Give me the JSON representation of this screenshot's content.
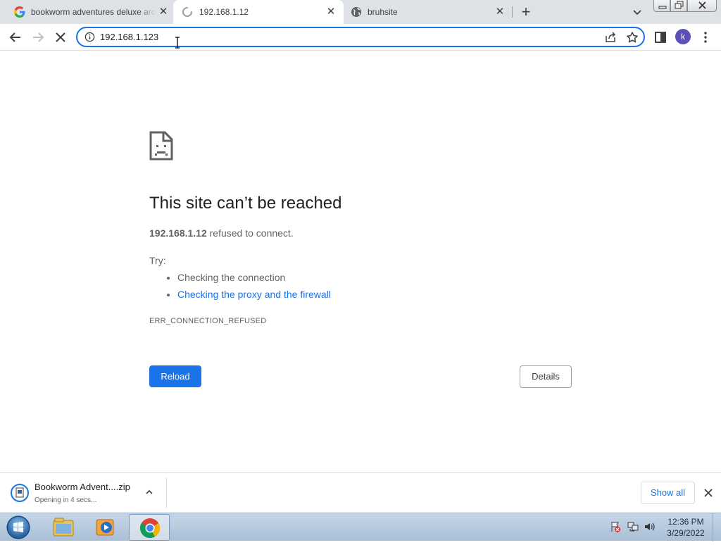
{
  "tabs": [
    {
      "title": "bookworm adventures deluxe archive",
      "favicon": "google-icon"
    },
    {
      "title": "192.168.1.12",
      "favicon": "loading-spinner-icon",
      "active": true
    },
    {
      "title": "bruhsite",
      "favicon": "globe-icon"
    }
  ],
  "omnibox": {
    "text": "192.168.1.123"
  },
  "profile": {
    "initial": "k",
    "color": "#5b4fb8"
  },
  "error": {
    "title": "This site can’t be reached",
    "host": "192.168.1.12",
    "summary_rest": " refused to connect.",
    "try_label": "Try:",
    "suggestions": [
      "Checking the connection",
      "Checking the proxy and the firewall"
    ],
    "code": "ERR_CONNECTION_REFUSED",
    "reload_label": "Reload",
    "details_label": "Details"
  },
  "download": {
    "name": "Bookworm Advent....zip",
    "status": "Opening in 4 secs...",
    "show_all_label": "Show all"
  },
  "taskbar": {
    "apps": [
      "windows-explorer-icon",
      "media-player-icon",
      "chrome-icon"
    ],
    "time": "12:36 PM",
    "date": "3/29/2022"
  },
  "colors": {
    "accent": "#1a73e8",
    "tabstrip": "#dee1e6"
  }
}
